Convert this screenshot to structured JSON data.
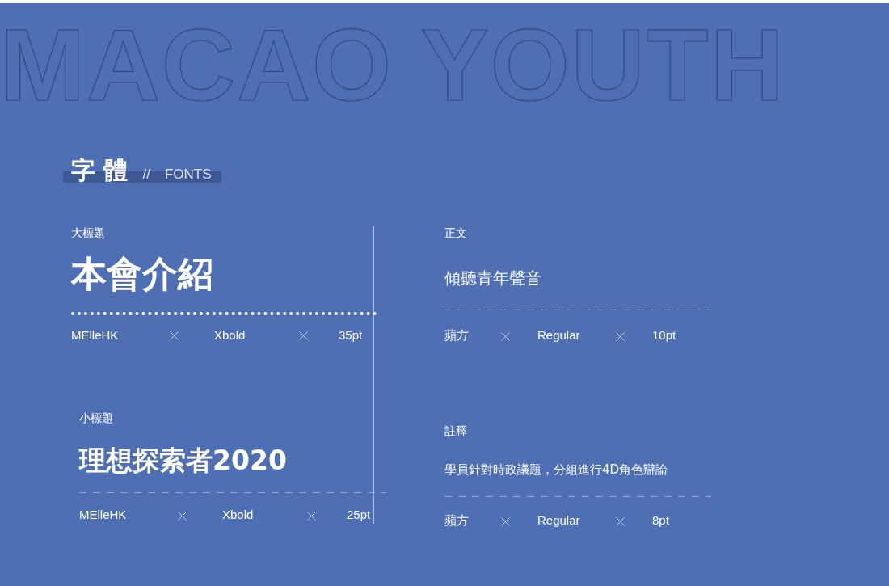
{
  "backdrop_text": "MACAO YOUTH",
  "section": {
    "title": "字 體",
    "separator": "//",
    "subtitle": "FONTS"
  },
  "specimens": [
    {
      "kind": "heading",
      "label": "大標題",
      "sample": "本會介紹",
      "dotted_rule": true,
      "font": "MElleHK",
      "weight": "Xbold",
      "size": "35pt"
    },
    {
      "kind": "body",
      "label": "正文",
      "sample": "傾聽青年聲音",
      "dotted_rule": false,
      "font": "蘋方",
      "weight": "Regular",
      "size": "10pt"
    },
    {
      "kind": "subheading",
      "label": "小標題",
      "sample": "理想探索者2020",
      "dotted_rule": false,
      "font": "MElleHK",
      "weight": "Xbold",
      "size": "25pt"
    },
    {
      "kind": "note",
      "label": "註釋",
      "sample": "學員針對時政議題，分組進行4D角色辯論",
      "dotted_rule": false,
      "font": "蘋方",
      "weight": "Regular",
      "size": "8pt"
    }
  ]
}
